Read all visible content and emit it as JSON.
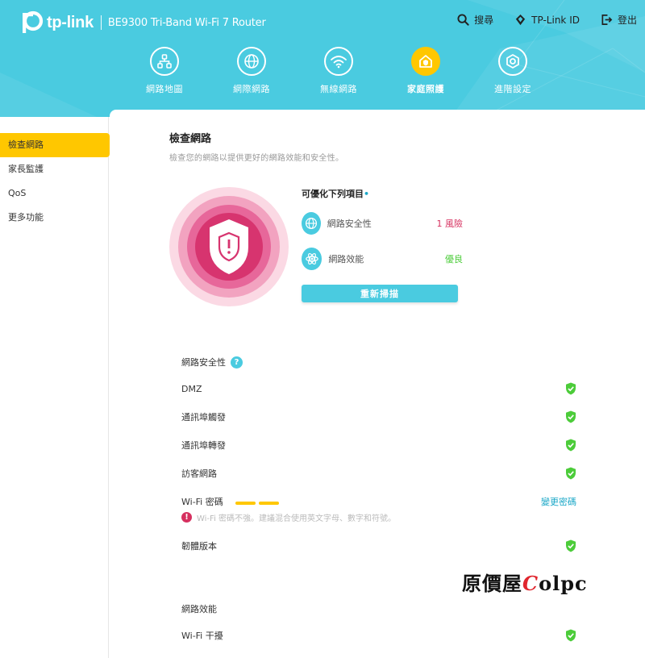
{
  "header": {
    "brand": "tp-link",
    "model": "BE9300 Tri-Band Wi-Fi 7 Router",
    "actions": [
      {
        "label": "搜尋",
        "icon": "search-icon"
      },
      {
        "label": "TP-Link ID",
        "icon": "tplink-id-icon"
      },
      {
        "label": "登出",
        "icon": "logout-icon"
      }
    ],
    "nav": [
      {
        "label": "網路地圖",
        "icon": "network-map-icon"
      },
      {
        "label": "網際網路",
        "icon": "globe-icon"
      },
      {
        "label": "無線網路",
        "icon": "wifi-icon"
      },
      {
        "label": "家庭照護",
        "icon": "home-care-icon",
        "active": true
      },
      {
        "label": "進階設定",
        "icon": "advanced-gear-icon"
      }
    ]
  },
  "sidebar": {
    "items": [
      {
        "label": "檢查網路",
        "active": true
      },
      {
        "label": "家長監護"
      },
      {
        "label": "QoS"
      },
      {
        "label": "更多功能"
      }
    ]
  },
  "main": {
    "title": "檢查網路",
    "subtitle": "檢查您的網路以提供更好的網路效能和安全性。",
    "summary": {
      "title": "可優化下列項目",
      "title_dot": "•",
      "rows": [
        {
          "label": "網路安全性",
          "value": "1 風險",
          "icon": "globe-icon"
        },
        {
          "label": "網路效能",
          "value": "優良",
          "icon": "atom-icon"
        }
      ],
      "rescan_label": "重新掃描"
    },
    "security": {
      "title": "網路安全性",
      "help": "?",
      "items": [
        "DMZ",
        "通訊埠觸發",
        "通訊埠轉發",
        "訪客網路"
      ],
      "wifi_password": {
        "label": "Wi-Fi 密碼",
        "strength_bars": 2,
        "change_label": "變更密碼",
        "warning_mark": "!",
        "warning": "Wi-Fi 密碼不強。建議混合使用英文字母、數字和符號。"
      },
      "firmware": "韌體版本"
    },
    "performance": {
      "title": "網路效能",
      "items": [
        "Wi-Fi 干擾"
      ]
    }
  },
  "watermark": {
    "text_a": "原價屋",
    "text_c": "C",
    "text_b": "olpc"
  },
  "colors": {
    "header": "#4acbe0",
    "active": "#ffc700",
    "risk": "#d6305f",
    "good": "#4ccc3a",
    "link": "#1aa7c7"
  }
}
